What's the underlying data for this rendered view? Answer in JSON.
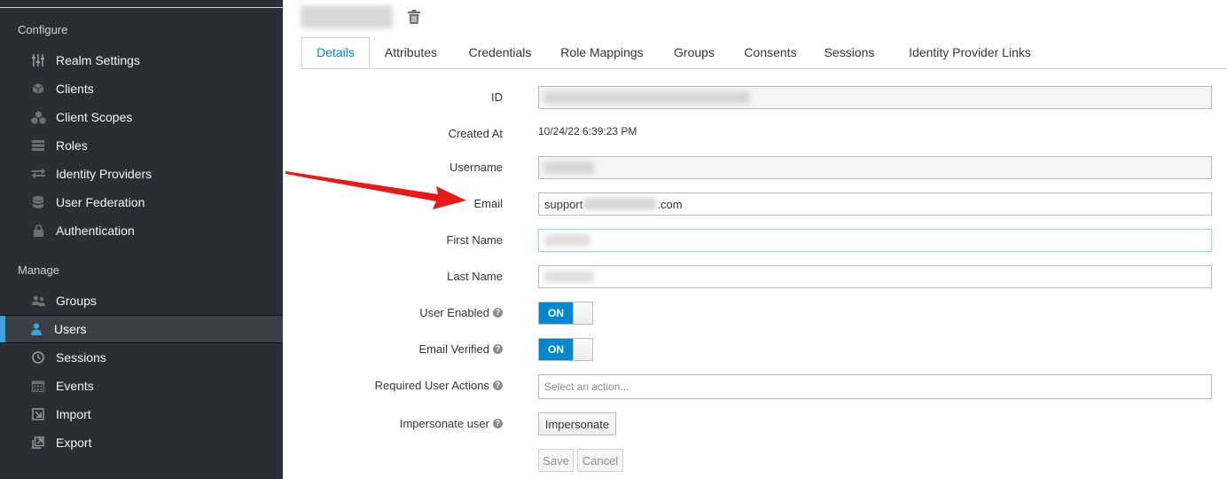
{
  "sidebar": {
    "configure_title": "Configure",
    "manage_title": "Manage",
    "configure_items": [
      {
        "label": "Realm Settings",
        "icon": "sliders-icon"
      },
      {
        "label": "Clients",
        "icon": "cube-icon"
      },
      {
        "label": "Client Scopes",
        "icon": "cubes-icon"
      },
      {
        "label": "Roles",
        "icon": "list-icon"
      },
      {
        "label": "Identity Providers",
        "icon": "exchange-icon"
      },
      {
        "label": "User Federation",
        "icon": "database-icon"
      },
      {
        "label": "Authentication",
        "icon": "lock-icon"
      }
    ],
    "manage_items": [
      {
        "label": "Groups",
        "icon": "users-icon"
      },
      {
        "label": "Users",
        "icon": "user-icon",
        "active": true
      },
      {
        "label": "Sessions",
        "icon": "clock-icon"
      },
      {
        "label": "Events",
        "icon": "calendar-icon"
      },
      {
        "label": "Import",
        "icon": "import-icon"
      },
      {
        "label": "Export",
        "icon": "export-icon"
      }
    ]
  },
  "header": {
    "delete_icon": "trash-icon"
  },
  "tabs": [
    {
      "label": "Details",
      "active": true
    },
    {
      "label": "Attributes"
    },
    {
      "label": "Credentials"
    },
    {
      "label": "Role Mappings"
    },
    {
      "label": "Groups"
    },
    {
      "label": "Consents"
    },
    {
      "label": "Sessions"
    },
    {
      "label": "Identity Provider Links"
    }
  ],
  "form": {
    "id_label": "ID",
    "created_at_label": "Created At",
    "created_at_value": "10/24/22 6:39:23 PM",
    "username_label": "Username",
    "email_label": "Email",
    "email_prefix": "support",
    "email_suffix": ".com",
    "first_name_label": "First Name",
    "last_name_label": "Last Name",
    "user_enabled_label": "User Enabled",
    "user_enabled_value": "ON",
    "email_verified_label": "Email Verified",
    "email_verified_value": "ON",
    "required_actions_label": "Required User Actions",
    "required_actions_placeholder": "Select an action...",
    "impersonate_label": "Impersonate user",
    "impersonate_button": "Impersonate",
    "save_button": "Save",
    "cancel_button": "Cancel"
  },
  "colors": {
    "sidebar_bg": "#292e34",
    "accent": "#0088ce",
    "active_bar": "#39a5dc",
    "arrow": "#e8191b"
  }
}
